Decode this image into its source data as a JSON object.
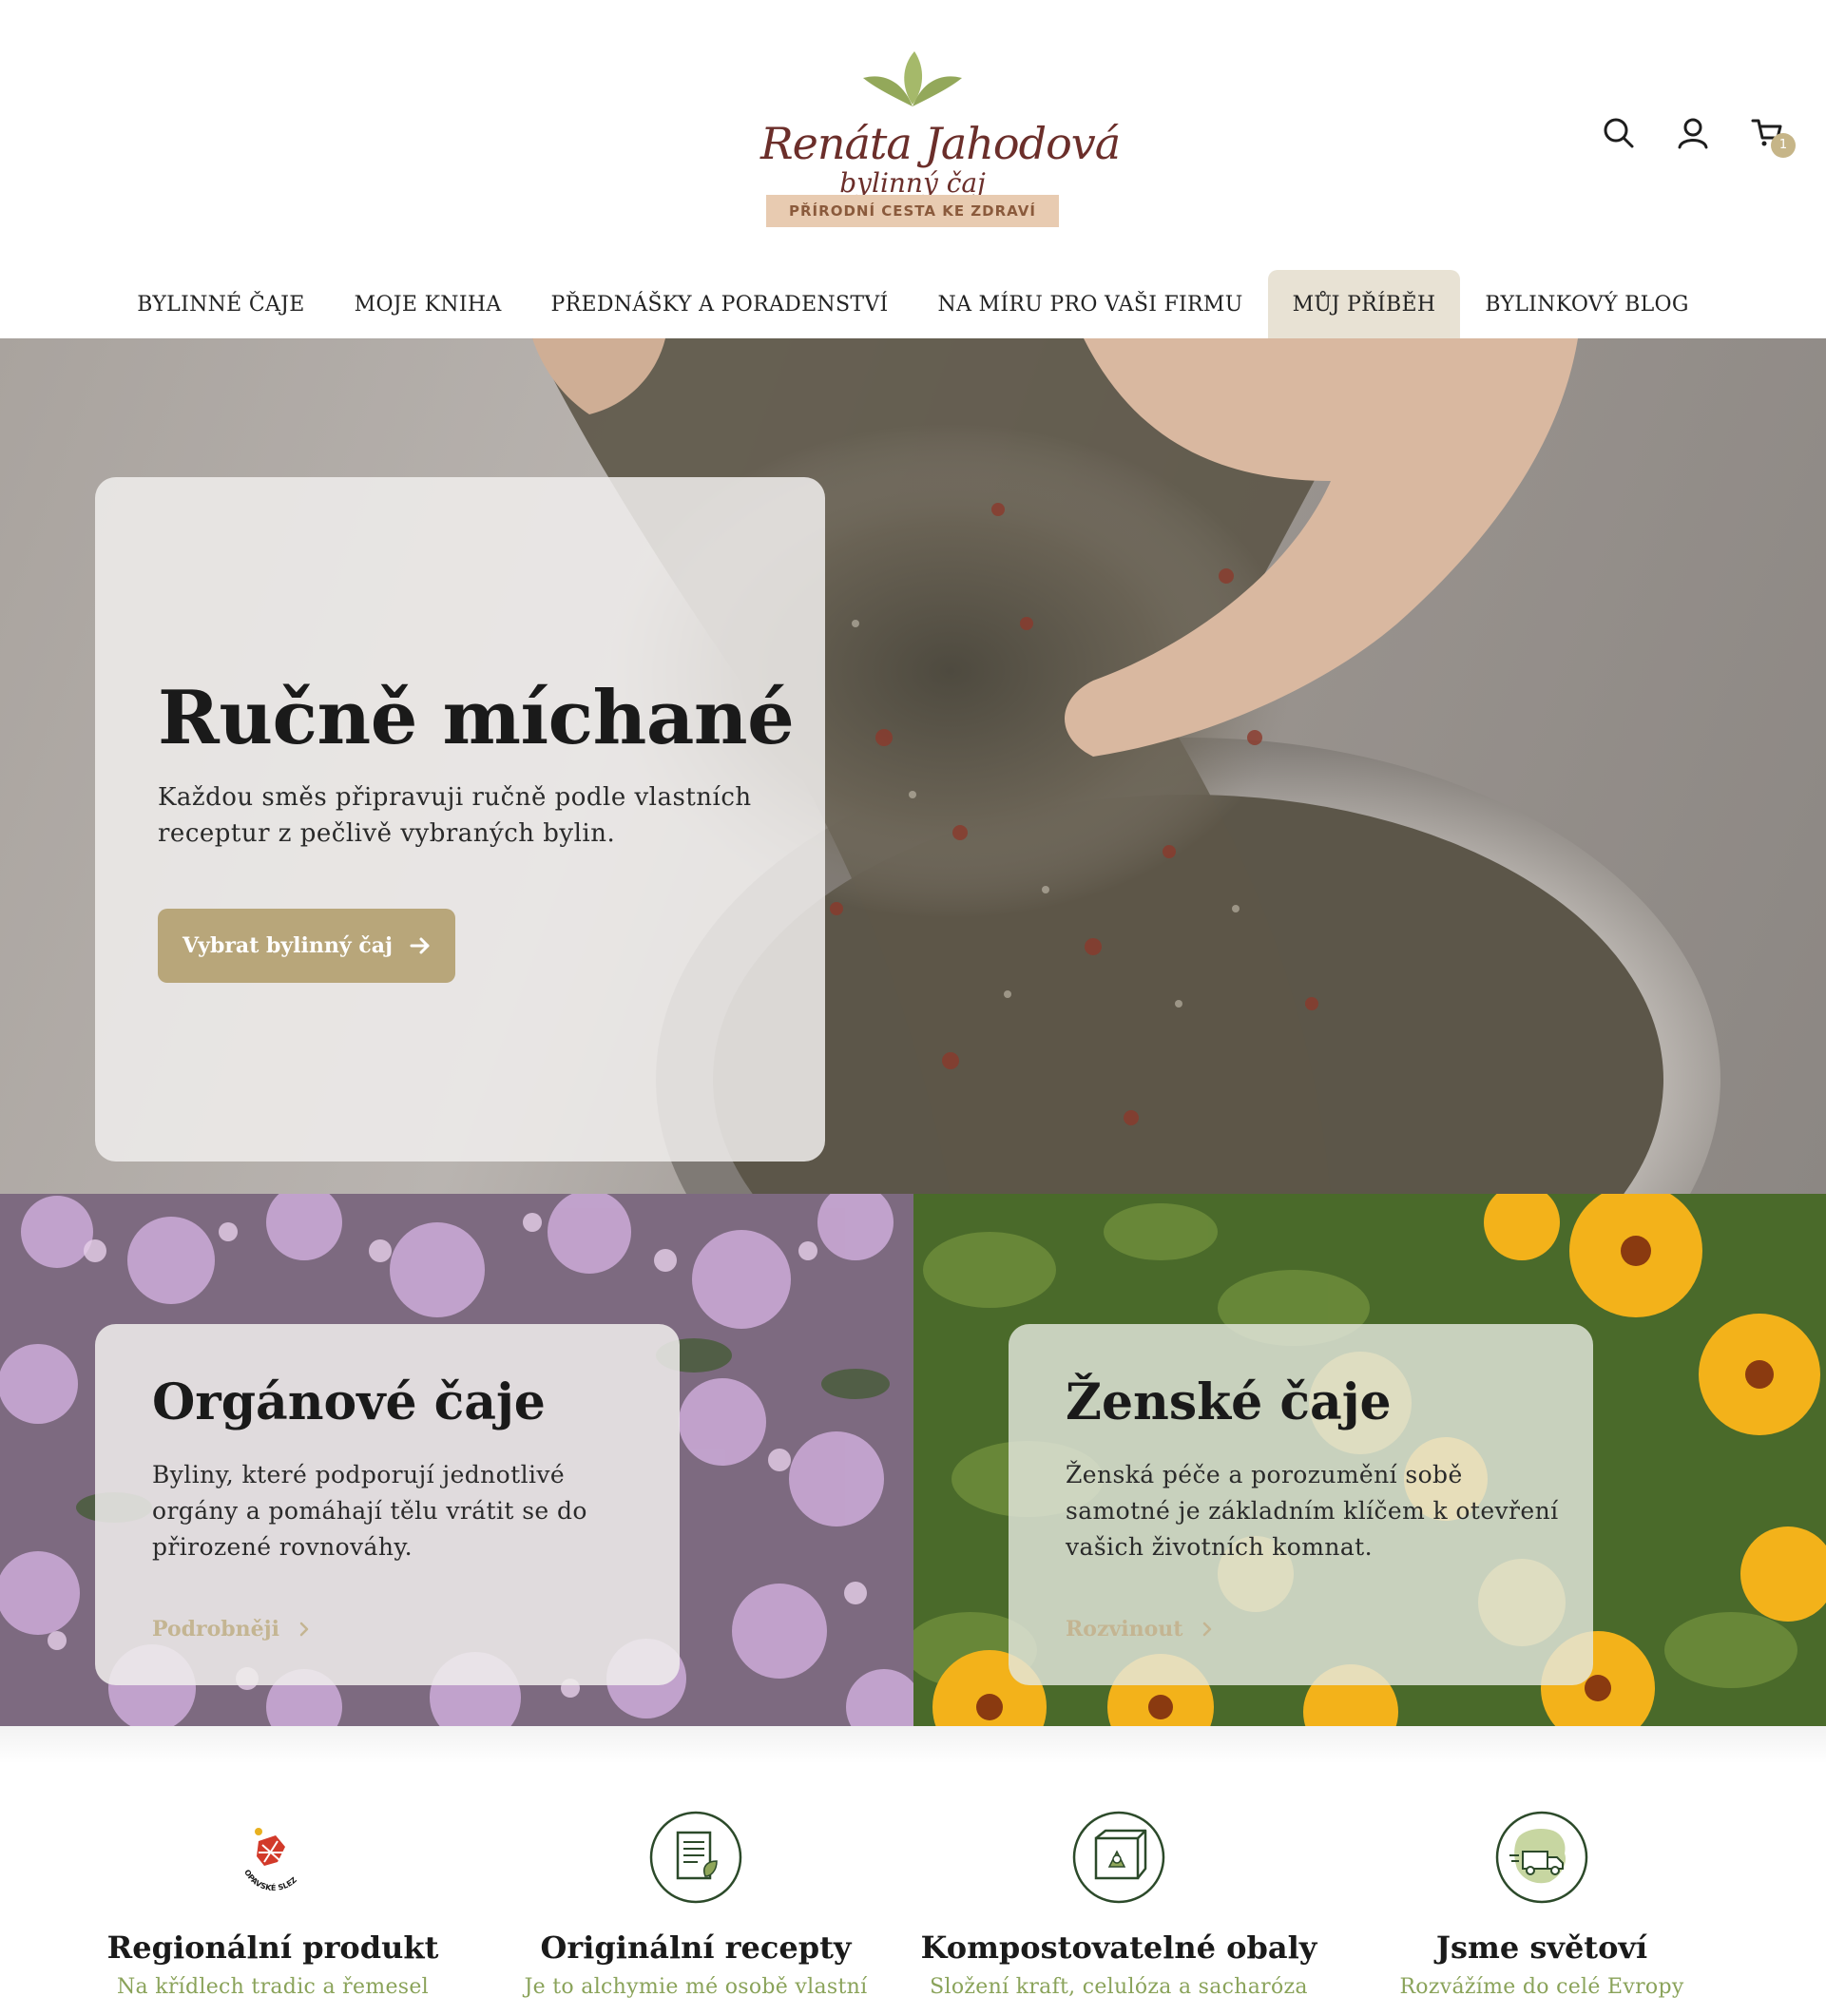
{
  "brand": {
    "name": "Renáta Jahodová",
    "subtitle": "bylinný čaj",
    "tagline": "PŘÍRODNÍ CESTA KE ZDRAVÍ",
    "colors": {
      "brown": "#6b2e2a",
      "leaf": "#8fa65a",
      "tag_bg": "#e8cbb1",
      "accent": "#b8a67a"
    }
  },
  "header": {
    "icons": [
      "search-icon",
      "user-icon",
      "cart-icon"
    ],
    "cart_count": "1"
  },
  "nav": {
    "items": [
      {
        "label": "BYLINNÉ ČAJE",
        "active": false
      },
      {
        "label": "MOJE KNIHA",
        "active": false
      },
      {
        "label": "PŘEDNÁŠKY A PORADENSTVÍ",
        "active": false
      },
      {
        "label": "NA MÍRU PRO VAŠI FIRMU",
        "active": false
      },
      {
        "label": "MŮJ PŘÍBĚH",
        "active": true
      },
      {
        "label": "BYLINKOVÝ BLOG",
        "active": false
      }
    ]
  },
  "hero": {
    "title": "Ručně míchané",
    "text": "Každou směs připravuji ručně podle vlastních receptur z pečlivě vybraných bylin.",
    "button_label": "Vybrat bylinný čaj"
  },
  "tiles": [
    {
      "title": "Orgánové čaje",
      "text": "Byliny, které podporují jednotlivé orgány a pomáhají tělu vrátit se do přirozené rovnováhy.",
      "link_label": "Podrobněji"
    },
    {
      "title": "Ženské čaje",
      "text": "Ženská péče a porozumění sobě samotné je základním klíčem k otevření vašich životních komnat.",
      "link_label": "Rozvinout"
    }
  ],
  "features": [
    {
      "icon": "regional-seal-icon",
      "seal_text": "OPAVSKÉ SLEZSKO",
      "title": "Regionální produkt",
      "subtitle": "Na křídlech tradic a řemesel"
    },
    {
      "icon": "recipe-document-icon",
      "title": "Originální recepty",
      "subtitle": "Je to alchymie mé osobě vlastní"
    },
    {
      "icon": "compostable-box-icon",
      "title": "Kompostovatelné obaly",
      "subtitle": "Složení kraft, celulóza a sacharóza"
    },
    {
      "icon": "delivery-truck-europe-icon",
      "title": "Jsme světoví",
      "subtitle": "Rozvážíme do celé Evropy"
    }
  ]
}
